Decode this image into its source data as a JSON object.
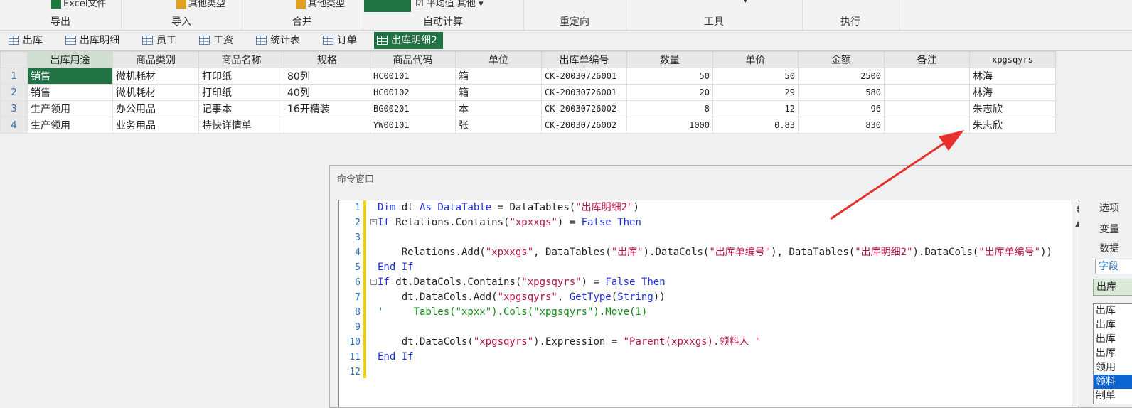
{
  "ribbon": {
    "groups": [
      {
        "title": "导出",
        "top": "Excel文件"
      },
      {
        "title": "导入",
        "top": "其他类型"
      },
      {
        "title": "合并",
        "top": "其他类型"
      },
      {
        "title": "自动计算",
        "top": "平均值  其他"
      },
      {
        "title": "重定向",
        "top": ""
      },
      {
        "title": "工具",
        "top": ""
      },
      {
        "title": "执行",
        "top": ""
      }
    ]
  },
  "tabs": [
    "出库",
    "出库明细",
    "员工",
    "工资",
    "统计表",
    "订单",
    "出库明细2"
  ],
  "grid": {
    "columns": [
      "出库用途",
      "商品类别",
      "商品名称",
      "规格",
      "商品代码",
      "单位",
      "出库单编号",
      "数量",
      "单价",
      "金额",
      "备注",
      "xpgsqyrs"
    ],
    "rows": [
      {
        "n": "1",
        "cells": [
          "销售",
          "微机耗材",
          "打印纸",
          "80列",
          "HC00101",
          "箱",
          "CK-20030726001",
          "50",
          "50",
          "2500",
          "",
          "林海"
        ]
      },
      {
        "n": "2",
        "cells": [
          "销售",
          "微机耗材",
          "打印纸",
          "40列",
          "HC00102",
          "箱",
          "CK-20030726001",
          "20",
          "29",
          "580",
          "",
          "林海"
        ]
      },
      {
        "n": "3",
        "cells": [
          "生产领用",
          "办公用品",
          "记事本",
          "16开精装",
          "BG00201",
          "本",
          "CK-20030726002",
          "8",
          "12",
          "96",
          "",
          "朱志欣"
        ]
      },
      {
        "n": "4",
        "cells": [
          "生产领用",
          "业务用品",
          "特快详情单",
          "",
          "YW00101",
          "张",
          "CK-20030726002",
          "1000",
          "0.83",
          "830",
          "",
          "朱志欣"
        ]
      }
    ]
  },
  "command_window": {
    "title": "命令窗口",
    "line_numbers": [
      "1",
      "2",
      "3",
      "4",
      "5",
      "6",
      "7",
      "8",
      "9",
      "10",
      "11",
      "12"
    ]
  },
  "right_panel": {
    "labels": [
      "选项",
      "变量",
      "数据"
    ],
    "field_box": "字段",
    "green_box": "出库",
    "list": [
      "出库",
      "出库",
      "出库",
      "出库",
      "领用",
      "领料",
      "制单"
    ]
  },
  "colors": {
    "accent": "#217346",
    "keyword": "#1d2fd8",
    "string": "#b4134b",
    "comment": "#128a18",
    "arrow": "#e8302a"
  }
}
